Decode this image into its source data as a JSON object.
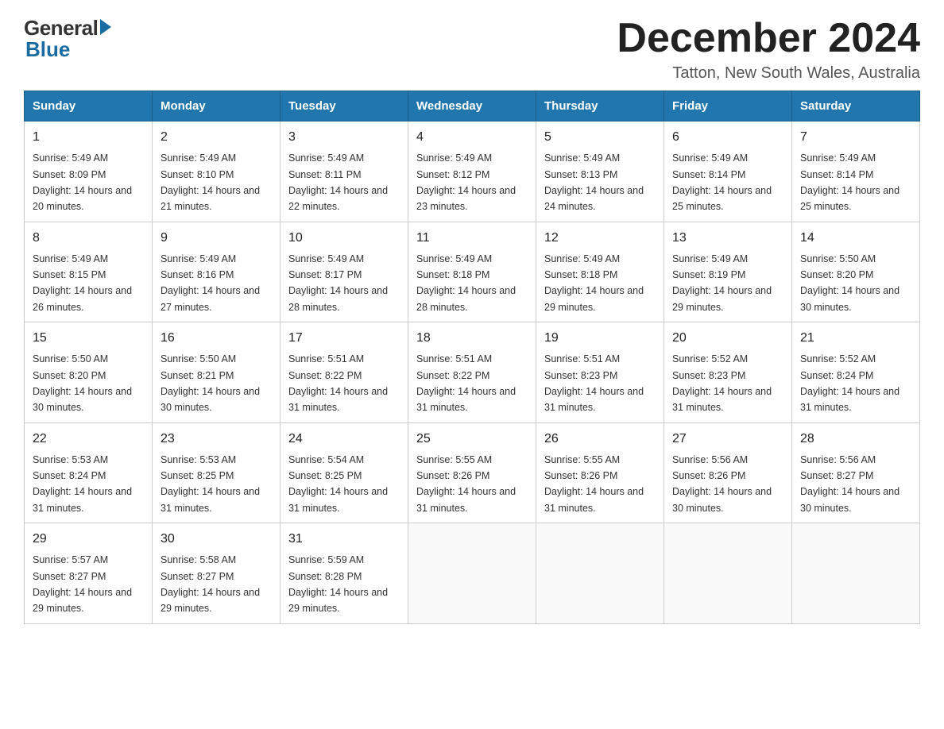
{
  "logo": {
    "general": "General",
    "blue": "Blue"
  },
  "header": {
    "title": "December 2024",
    "subtitle": "Tatton, New South Wales, Australia"
  },
  "weekdays": [
    "Sunday",
    "Monday",
    "Tuesday",
    "Wednesday",
    "Thursday",
    "Friday",
    "Saturday"
  ],
  "weeks": [
    [
      {
        "day": "1",
        "sunrise": "5:49 AM",
        "sunset": "8:09 PM",
        "daylight": "14 hours and 20 minutes."
      },
      {
        "day": "2",
        "sunrise": "5:49 AM",
        "sunset": "8:10 PM",
        "daylight": "14 hours and 21 minutes."
      },
      {
        "day": "3",
        "sunrise": "5:49 AM",
        "sunset": "8:11 PM",
        "daylight": "14 hours and 22 minutes."
      },
      {
        "day": "4",
        "sunrise": "5:49 AM",
        "sunset": "8:12 PM",
        "daylight": "14 hours and 23 minutes."
      },
      {
        "day": "5",
        "sunrise": "5:49 AM",
        "sunset": "8:13 PM",
        "daylight": "14 hours and 24 minutes."
      },
      {
        "day": "6",
        "sunrise": "5:49 AM",
        "sunset": "8:14 PM",
        "daylight": "14 hours and 25 minutes."
      },
      {
        "day": "7",
        "sunrise": "5:49 AM",
        "sunset": "8:14 PM",
        "daylight": "14 hours and 25 minutes."
      }
    ],
    [
      {
        "day": "8",
        "sunrise": "5:49 AM",
        "sunset": "8:15 PM",
        "daylight": "14 hours and 26 minutes."
      },
      {
        "day": "9",
        "sunrise": "5:49 AM",
        "sunset": "8:16 PM",
        "daylight": "14 hours and 27 minutes."
      },
      {
        "day": "10",
        "sunrise": "5:49 AM",
        "sunset": "8:17 PM",
        "daylight": "14 hours and 28 minutes."
      },
      {
        "day": "11",
        "sunrise": "5:49 AM",
        "sunset": "8:18 PM",
        "daylight": "14 hours and 28 minutes."
      },
      {
        "day": "12",
        "sunrise": "5:49 AM",
        "sunset": "8:18 PM",
        "daylight": "14 hours and 29 minutes."
      },
      {
        "day": "13",
        "sunrise": "5:49 AM",
        "sunset": "8:19 PM",
        "daylight": "14 hours and 29 minutes."
      },
      {
        "day": "14",
        "sunrise": "5:50 AM",
        "sunset": "8:20 PM",
        "daylight": "14 hours and 30 minutes."
      }
    ],
    [
      {
        "day": "15",
        "sunrise": "5:50 AM",
        "sunset": "8:20 PM",
        "daylight": "14 hours and 30 minutes."
      },
      {
        "day": "16",
        "sunrise": "5:50 AM",
        "sunset": "8:21 PM",
        "daylight": "14 hours and 30 minutes."
      },
      {
        "day": "17",
        "sunrise": "5:51 AM",
        "sunset": "8:22 PM",
        "daylight": "14 hours and 31 minutes."
      },
      {
        "day": "18",
        "sunrise": "5:51 AM",
        "sunset": "8:22 PM",
        "daylight": "14 hours and 31 minutes."
      },
      {
        "day": "19",
        "sunrise": "5:51 AM",
        "sunset": "8:23 PM",
        "daylight": "14 hours and 31 minutes."
      },
      {
        "day": "20",
        "sunrise": "5:52 AM",
        "sunset": "8:23 PM",
        "daylight": "14 hours and 31 minutes."
      },
      {
        "day": "21",
        "sunrise": "5:52 AM",
        "sunset": "8:24 PM",
        "daylight": "14 hours and 31 minutes."
      }
    ],
    [
      {
        "day": "22",
        "sunrise": "5:53 AM",
        "sunset": "8:24 PM",
        "daylight": "14 hours and 31 minutes."
      },
      {
        "day": "23",
        "sunrise": "5:53 AM",
        "sunset": "8:25 PM",
        "daylight": "14 hours and 31 minutes."
      },
      {
        "day": "24",
        "sunrise": "5:54 AM",
        "sunset": "8:25 PM",
        "daylight": "14 hours and 31 minutes."
      },
      {
        "day": "25",
        "sunrise": "5:55 AM",
        "sunset": "8:26 PM",
        "daylight": "14 hours and 31 minutes."
      },
      {
        "day": "26",
        "sunrise": "5:55 AM",
        "sunset": "8:26 PM",
        "daylight": "14 hours and 31 minutes."
      },
      {
        "day": "27",
        "sunrise": "5:56 AM",
        "sunset": "8:26 PM",
        "daylight": "14 hours and 30 minutes."
      },
      {
        "day": "28",
        "sunrise": "5:56 AM",
        "sunset": "8:27 PM",
        "daylight": "14 hours and 30 minutes."
      }
    ],
    [
      {
        "day": "29",
        "sunrise": "5:57 AM",
        "sunset": "8:27 PM",
        "daylight": "14 hours and 29 minutes."
      },
      {
        "day": "30",
        "sunrise": "5:58 AM",
        "sunset": "8:27 PM",
        "daylight": "14 hours and 29 minutes."
      },
      {
        "day": "31",
        "sunrise": "5:59 AM",
        "sunset": "8:28 PM",
        "daylight": "14 hours and 29 minutes."
      },
      null,
      null,
      null,
      null
    ]
  ]
}
